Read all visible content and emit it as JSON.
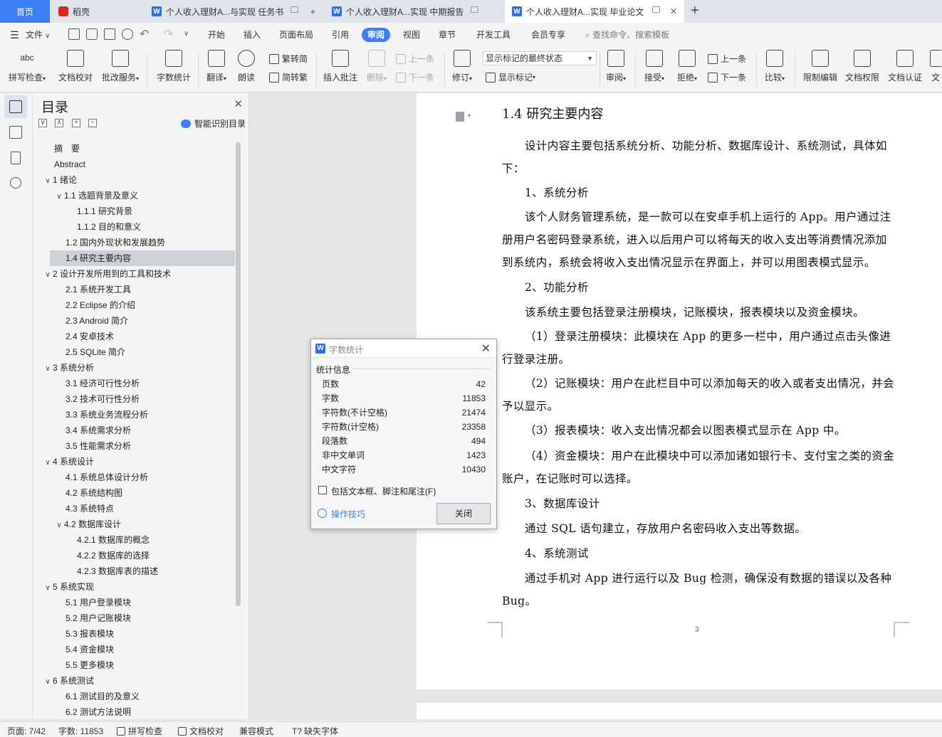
{
  "tabs": [
    {
      "label": "首页"
    },
    {
      "label": "稻壳"
    },
    {
      "label": "个人收入理财A...与实现 任务书"
    },
    {
      "label": "个人收入理财A...实现 中期报告"
    },
    {
      "label": "个人收入理财A...实现 毕业论文"
    }
  ],
  "new_tab": "+",
  "menubar": {
    "file": "文件",
    "items": [
      "开始",
      "插入",
      "页面布局",
      "引用",
      "审阅",
      "视图",
      "章节",
      "开发工具",
      "会员专享"
    ],
    "search_placeholder": "查找命令、搜索模板"
  },
  "ribbon": {
    "spell": "拼写检查",
    "spell_icon_text": "abc",
    "proof": "文档校对",
    "correct": "批改服务",
    "wordcount": "字数统计",
    "translate": "翻译",
    "read": "朗读",
    "trad": "繁转简",
    "simp": "简转繁",
    "insert_comment": "插入批注",
    "delete": "删除",
    "prev_comment": "上一条",
    "next_comment": "下一条",
    "revise": "修订",
    "markup_select": "显示标记的最终状态",
    "show_markup": "显示标记",
    "review": "审阅",
    "accept": "接受",
    "reject": "拒绝",
    "prev": "上一条",
    "next": "下一条",
    "compare": "比较",
    "restrict": "限制编辑",
    "permission": "文档权限",
    "cert": "文档认证",
    "more": "文"
  },
  "toc": {
    "title": "目录",
    "smart": "智能识别目录",
    "items": [
      {
        "label": "摘　要",
        "level": 0,
        "chev": ""
      },
      {
        "label": "Abstract",
        "level": 0,
        "chev": ""
      },
      {
        "label": "1 绪论",
        "level": 0,
        "chev": "∨"
      },
      {
        "label": "1.1 选题背景及意义",
        "level": 1,
        "chev": "∨"
      },
      {
        "label": "1.1.1  研究背景",
        "level": 2,
        "chev": ""
      },
      {
        "label": "1.1.2  目的和意义",
        "level": 2,
        "chev": ""
      },
      {
        "label": "1.2 国内外现状和发展趋势",
        "level": 1,
        "chev": ""
      },
      {
        "label": "1.4  研究主要内容",
        "level": 1,
        "chev": "",
        "selected": true
      },
      {
        "label": "2 设计开发所用到的工具和技术",
        "level": 0,
        "chev": "∨"
      },
      {
        "label": "2.1 系统开发工具",
        "level": 1,
        "chev": ""
      },
      {
        "label": "2.2 Eclipse 的介绍",
        "level": 1,
        "chev": ""
      },
      {
        "label": "2.3 Android 简介",
        "level": 1,
        "chev": ""
      },
      {
        "label": "2.4 安卓技术",
        "level": 1,
        "chev": ""
      },
      {
        "label": "2.5 SQLite 简介",
        "level": 1,
        "chev": ""
      },
      {
        "label": "3 系统分析",
        "level": 0,
        "chev": "∨"
      },
      {
        "label": "3.1  经济可行性分析",
        "level": 1,
        "chev": ""
      },
      {
        "label": "3.2  技术可行性分析",
        "level": 1,
        "chev": ""
      },
      {
        "label": "3.3  系统业务流程分析",
        "level": 1,
        "chev": ""
      },
      {
        "label": "3.4  系统需求分析",
        "level": 1,
        "chev": ""
      },
      {
        "label": "3.5  性能需求分析",
        "level": 1,
        "chev": ""
      },
      {
        "label": "4 系统设计",
        "level": 0,
        "chev": "∨"
      },
      {
        "label": "4.1 系统总体设计分析",
        "level": 1,
        "chev": ""
      },
      {
        "label": "4.2 系统结构图",
        "level": 1,
        "chev": ""
      },
      {
        "label": "4.3 系统特点",
        "level": 1,
        "chev": ""
      },
      {
        "label": "4.2 数据库设计",
        "level": 1,
        "chev": "∨"
      },
      {
        "label": "4.2.1 数据库的概念",
        "level": 2,
        "chev": ""
      },
      {
        "label": "4.2.2 数据库的选择",
        "level": 2,
        "chev": ""
      },
      {
        "label": "4.2.3 数据库表的描述",
        "level": 2,
        "chev": ""
      },
      {
        "label": "5 系统实现",
        "level": 0,
        "chev": "∨"
      },
      {
        "label": "5.1 用户登录模块",
        "level": 1,
        "chev": ""
      },
      {
        "label": "5.2 用户记账模块",
        "level": 1,
        "chev": ""
      },
      {
        "label": "5.3 报表模块",
        "level": 1,
        "chev": ""
      },
      {
        "label": "5.4 资金模块",
        "level": 1,
        "chev": ""
      },
      {
        "label": "5.5 更多模块",
        "level": 1,
        "chev": ""
      },
      {
        "label": "6 系统测试",
        "level": 0,
        "chev": "∨"
      },
      {
        "label": "6.1 测试目的及意义",
        "level": 1,
        "chev": ""
      },
      {
        "label": "6.2 测试方法说明",
        "level": 1,
        "chev": ""
      }
    ]
  },
  "document": {
    "heading": "1.4  研究主要内容",
    "paragraphs": [
      "设计内容主要包括系统分析、功能分析、数据库设计、系统测试，具体如下：",
      "1、系统分析",
      "该个人财务管理系统，是一款可以在安卓手机上运行的 App。用户通过注册用户名密码登录系统，进入以后用户可以将每天的收入支出等消费情况添加到系统内，系统会将收入支出情况显示在界面上，并可以用图表模式显示。",
      "2、功能分析",
      "该系统主要包括登录注册模块，记账模块，报表模块以及资金模块。",
      "（1）登录注册模块：此模块在 App 的更多一栏中，用户通过点击头像进行登录注册。",
      "（2）记账模块：用户在此栏目中可以添加每天的收入或者支出情况，并会予以显示。",
      "（3）报表模块：收入支出情况都会以图表模式显示在 App 中。",
      "（4）资金模块：用户在此模块中可以添加诸如银行卡、支付宝之类的资金账户，在记账时可以选择。",
      "3、数据库设计",
      "通过 SQL 语句建立，存放用户名密码收入支出等数据。",
      "4、系统测试",
      "通过手机对 App 进行运行以及 Bug 检测，确保没有数据的错误以及各种 Bug。"
    ],
    "page_number": "3"
  },
  "dialog": {
    "title": "字数统计",
    "section": "统计信息",
    "rows": [
      {
        "label": "页数",
        "value": "42"
      },
      {
        "label": "字数",
        "value": "11853"
      },
      {
        "label": "字符数(不计空格)",
        "value": "21474"
      },
      {
        "label": "字符数(计空格)",
        "value": "23358"
      },
      {
        "label": "段落数",
        "value": "494"
      },
      {
        "label": "非中文单词",
        "value": "1423"
      },
      {
        "label": "中文字符",
        "value": "10430"
      }
    ],
    "checkbox_label": "包括文本框、脚注和尾注(F)",
    "tips": "操作技巧",
    "close_button": "关闭"
  },
  "status": {
    "page": "页面: 7/42",
    "words": "字数: 11853",
    "spell": "拼写检查",
    "proof": "文档校对",
    "compat": "兼容模式",
    "missing_font": "缺失字体"
  },
  "colors": {
    "accent": "#3d7ef5",
    "wps_red": "#e2231a"
  }
}
